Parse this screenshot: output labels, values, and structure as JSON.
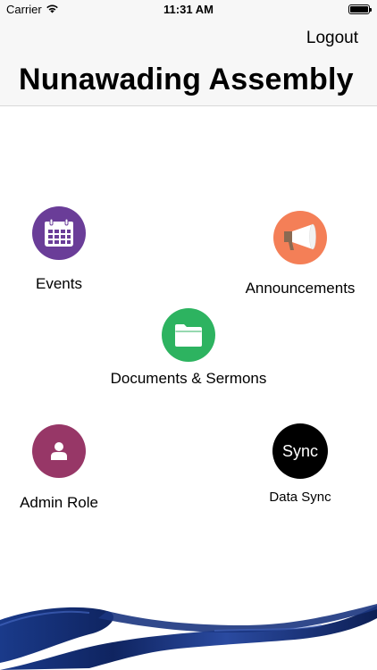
{
  "status_bar": {
    "carrier": "Carrier",
    "time": "11:31 AM"
  },
  "nav": {
    "logout_label": "Logout",
    "title": "Nunawading Assembly"
  },
  "menu": {
    "events": {
      "label": "Events",
      "icon": "calendar-icon",
      "color": "#6a3d98"
    },
    "announcements": {
      "label": "Announcements",
      "icon": "megaphone-icon",
      "color": "#f47f57"
    },
    "documents": {
      "label": "Documents & Sermons",
      "icon": "folder-icon",
      "color": "#2db360"
    },
    "admin": {
      "label": "Admin Role",
      "icon": "user-icon",
      "color": "#973767"
    },
    "sync": {
      "icon_text": "Sync",
      "label": "Data Sync",
      "color": "#000000"
    }
  },
  "decoration": {
    "ribbon_color": "#152d6e"
  }
}
